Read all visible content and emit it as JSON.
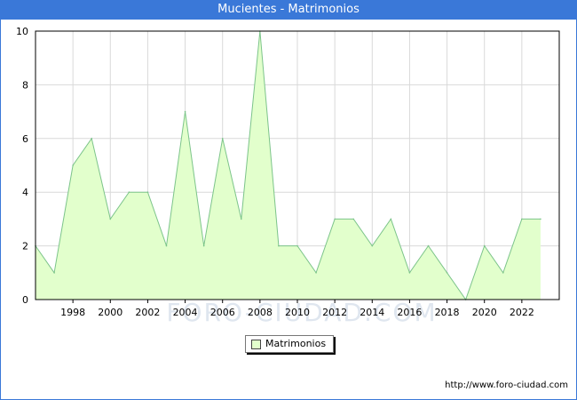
{
  "page": {
    "title": "Mucientes - Matrimonios",
    "watermark": "FORO-CIUDAD.COM",
    "footer_url": "http://www.foro-ciudad.com"
  },
  "colors": {
    "title_bar": "#3a78d8",
    "area_fill": "#e2ffcc",
    "area_line": "#7cc48a",
    "grid": "#d9d9d9"
  },
  "chart_data": {
    "type": "area",
    "title": "Mucientes - Matrimonios",
    "xlabel": "",
    "ylabel": "",
    "x": [
      1996,
      1997,
      1998,
      1999,
      2000,
      2001,
      2002,
      2003,
      2004,
      2005,
      2006,
      2007,
      2008,
      2009,
      2010,
      2011,
      2012,
      2013,
      2014,
      2015,
      2016,
      2017,
      2018,
      2019,
      2020,
      2021,
      2022,
      2023
    ],
    "series": [
      {
        "name": "Matrimonios",
        "values": [
          2,
          1,
          5,
          6,
          3,
          4,
          4,
          2,
          7,
          2,
          6,
          3,
          10,
          2,
          2,
          1,
          3,
          3,
          2,
          3,
          1,
          2,
          1,
          0,
          2,
          1,
          3,
          3
        ]
      }
    ],
    "x_ticks": [
      "1998",
      "2000",
      "2002",
      "2004",
      "2006",
      "2008",
      "2010",
      "2012",
      "2014",
      "2016",
      "2018",
      "2020",
      "2022"
    ],
    "y_ticks": [
      "0",
      "2",
      "4",
      "6",
      "8",
      "10"
    ],
    "xlim": [
      1996,
      2024
    ],
    "ylim": [
      0,
      10
    ],
    "grid": true,
    "legend_position": "bottom-center"
  }
}
